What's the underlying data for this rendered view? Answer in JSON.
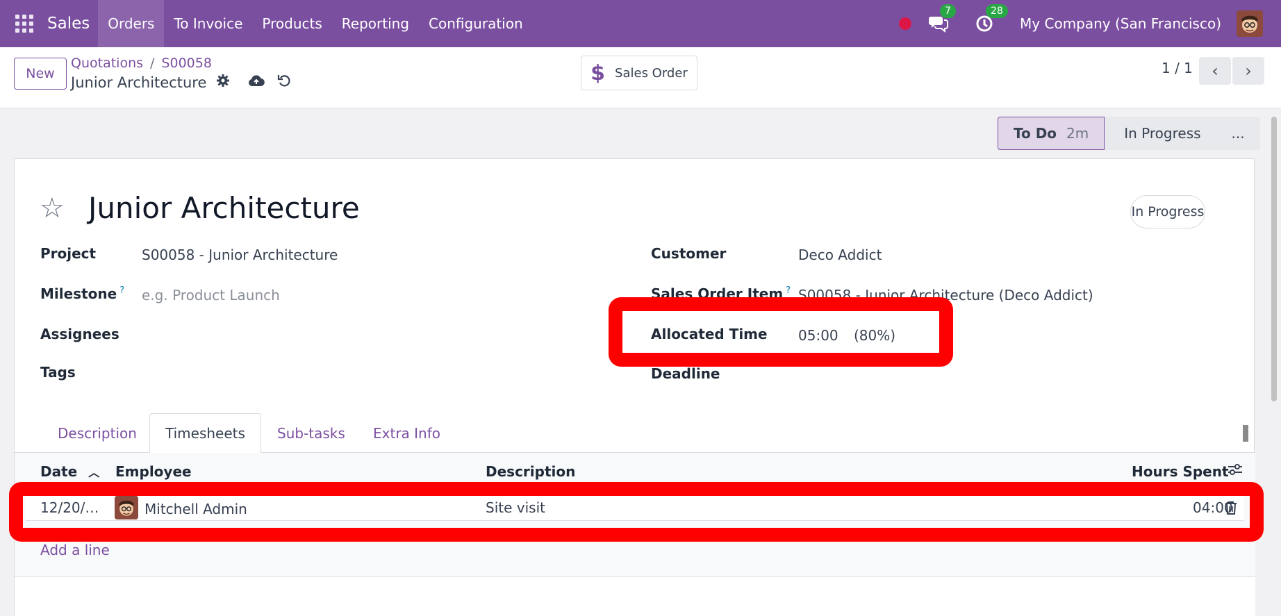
{
  "navbar": {
    "brand": "Sales",
    "menu": [
      "Orders",
      "To Invoice",
      "Products",
      "Reporting",
      "Configuration"
    ],
    "active_menu": "Orders",
    "messages_count": "7",
    "activities_count": "28",
    "company": "My Company (San Francisco)",
    "record_dot_color": "#dc1748"
  },
  "control": {
    "new_label": "New",
    "breadcrumb": [
      "Quotations",
      "S00058"
    ],
    "record_name": "Junior Architecture",
    "smart_button": "Sales Order",
    "pager": "1 / 1"
  },
  "stages": {
    "current": "To Do",
    "current_duration": "2m",
    "next": "In Progress",
    "more": "..."
  },
  "task": {
    "title": "Junior Architecture",
    "state_pill": "In Progress",
    "fields_left": {
      "project_label": "Project",
      "project_value": "S00058 - Junior Architecture",
      "milestone_label": "Milestone",
      "milestone_help": "?",
      "milestone_placeholder": "e.g. Product Launch",
      "assignees_label": "Assignees",
      "tags_label": "Tags"
    },
    "fields_right": {
      "customer_label": "Customer",
      "customer_value": "Deco Addict",
      "so_item_label": "Sales Order Item",
      "so_item_help": "?",
      "so_item_value": "S00058 - Junior Architecture (Deco Addict)",
      "allocated_label": "Allocated Time",
      "allocated_value": "05:00",
      "allocated_percent": "(80%)",
      "deadline_label": "Deadline"
    }
  },
  "tabs": [
    "Description",
    "Timesheets",
    "Sub-tasks",
    "Extra Info"
  ],
  "active_tab": "Timesheets",
  "timesheet": {
    "columns": [
      "Date",
      "Employee",
      "Description",
      "Hours Spent"
    ],
    "rows": [
      {
        "date": "12/20/…",
        "employee": "Mitchell Admin",
        "description": "Site visit",
        "hours": "04:00"
      }
    ],
    "add_line": "Add a line"
  },
  "colors": {
    "brand": "#7b4fa0",
    "annotation": "#ff0000"
  }
}
